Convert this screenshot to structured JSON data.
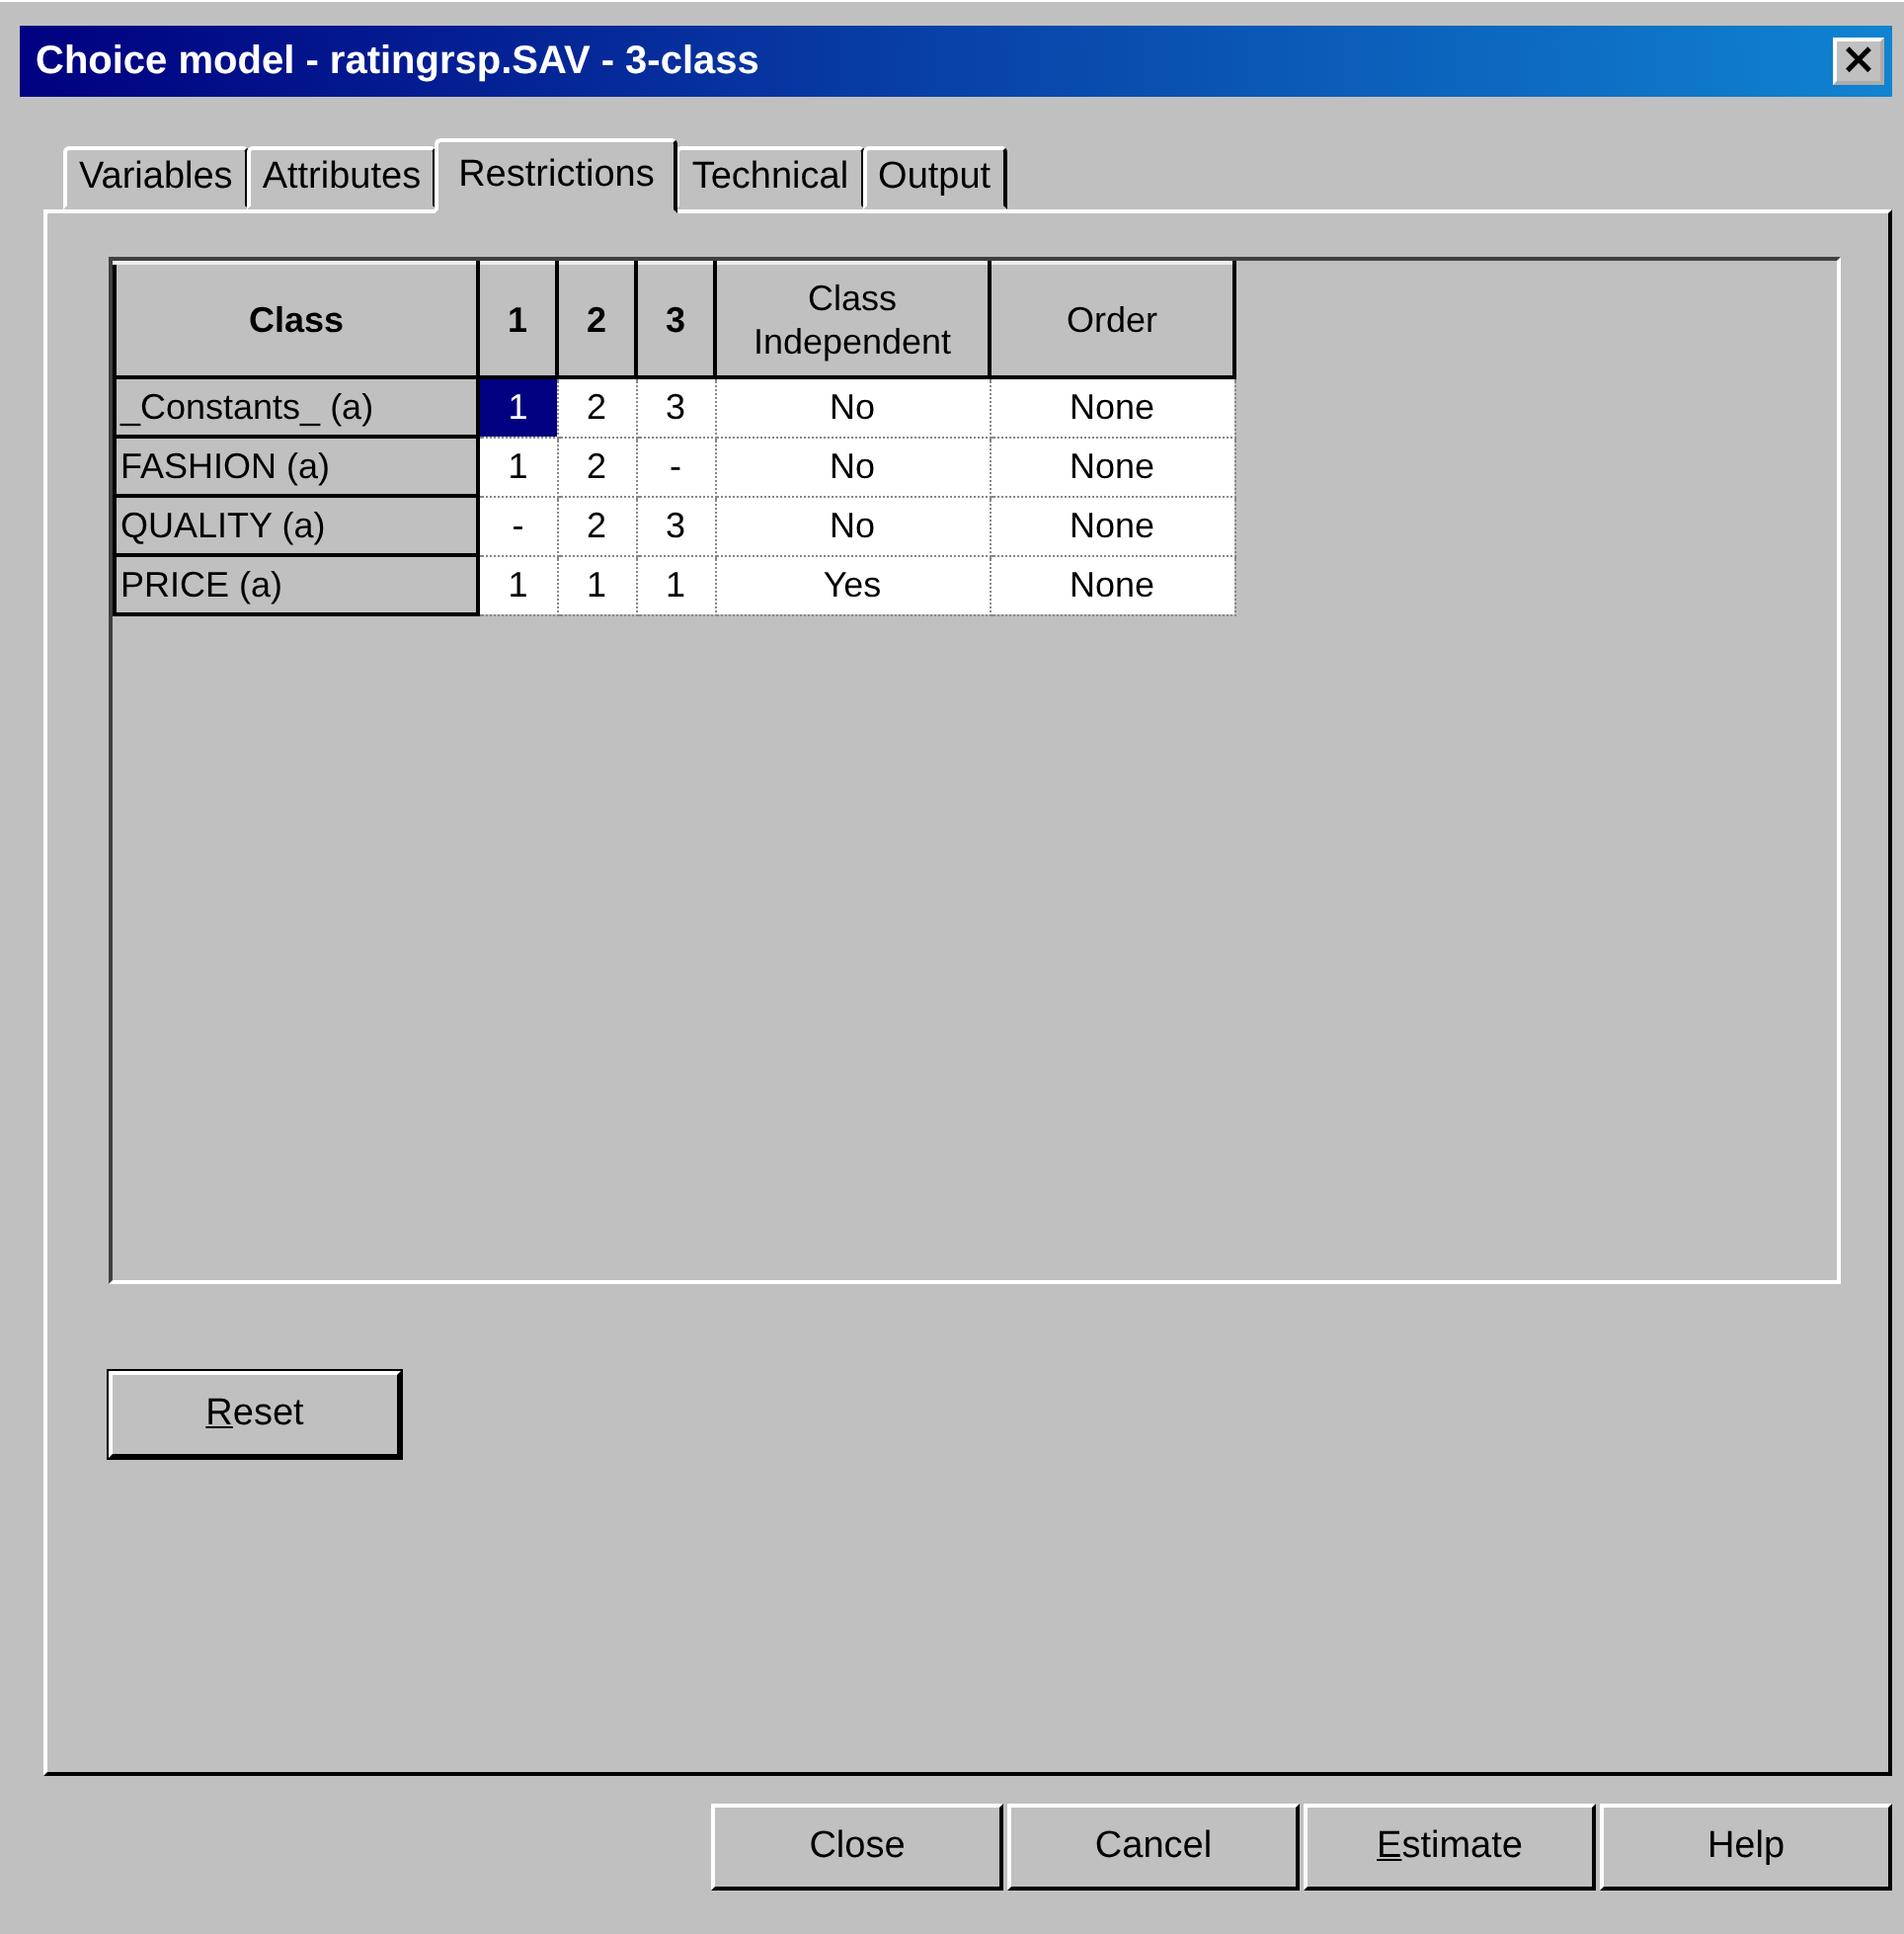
{
  "window": {
    "title": "Choice model - ratingrsp.SAV - 3-class",
    "close": "×"
  },
  "tabs": [
    {
      "label": "Variables",
      "selected": false
    },
    {
      "label": "Attributes",
      "selected": false
    },
    {
      "label": "Restrictions",
      "selected": true
    },
    {
      "label": "Technical",
      "selected": false
    },
    {
      "label": "Output",
      "selected": false
    }
  ],
  "table": {
    "columns": [
      "Class",
      "1",
      "2",
      "3",
      "Class Independent",
      "Order"
    ],
    "rows": [
      {
        "cells": [
          {
            "text": "_Constants_ (a)",
            "selected": false
          },
          {
            "text": "1",
            "selected": true
          },
          {
            "text": "2",
            "selected": false
          },
          {
            "text": "3",
            "selected": false
          },
          {
            "text": "No",
            "selected": false
          },
          {
            "text": "None",
            "selected": false
          }
        ]
      },
      {
        "cells": [
          {
            "text": "FASHION (a)",
            "selected": false
          },
          {
            "text": "1",
            "selected": false
          },
          {
            "text": "2",
            "selected": false
          },
          {
            "text": "-",
            "selected": false
          },
          {
            "text": "No",
            "selected": false
          },
          {
            "text": "None",
            "selected": false
          }
        ]
      },
      {
        "cells": [
          {
            "text": "QUALITY (a)",
            "selected": false
          },
          {
            "text": "-",
            "selected": false
          },
          {
            "text": "2",
            "selected": false
          },
          {
            "text": "3",
            "selected": false
          },
          {
            "text": "No",
            "selected": false
          },
          {
            "text": "None",
            "selected": false
          }
        ]
      },
      {
        "cells": [
          {
            "text": "PRICE (a)",
            "selected": false
          },
          {
            "text": "1",
            "selected": false
          },
          {
            "text": "1",
            "selected": false
          },
          {
            "text": "1",
            "selected": false
          },
          {
            "text": "Yes",
            "selected": false
          },
          {
            "text": "None",
            "selected": false
          }
        ]
      }
    ]
  },
  "reset_button": {
    "label": "Reset",
    "mnemonic": true
  },
  "buttons": [
    {
      "label": "Close",
      "mnemonic": false
    },
    {
      "label": "Cancel",
      "mnemonic": false
    },
    {
      "label": "Estimate",
      "mnemonic": true
    },
    {
      "label": "Help",
      "mnemonic": false
    }
  ]
}
